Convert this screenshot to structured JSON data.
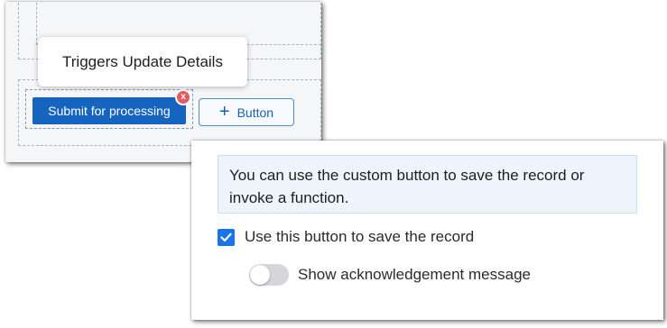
{
  "builder": {
    "submit_button_label": "Submit for processing",
    "remove_badge_label": "x",
    "add_button_plus": "+",
    "add_button_label": "Button",
    "tooltip_text": "Triggers Update Details"
  },
  "settings": {
    "info_text": "You can use the custom button to save the record or invoke a function.",
    "save_record_checkbox": {
      "label": "Use this button to save the record",
      "checked": true
    },
    "acknowledgement_toggle": {
      "label": "Show acknowledgement message",
      "on": false
    }
  },
  "colors": {
    "primary_button": "#1565c0",
    "checkbox_accent": "#1a73e8",
    "remove_badge": "#e35d5d",
    "info_background": "#eef4fc"
  },
  "icons": {
    "add_icon": "plus",
    "remove_icon": "close",
    "checkbox_icon": "checkmark"
  }
}
